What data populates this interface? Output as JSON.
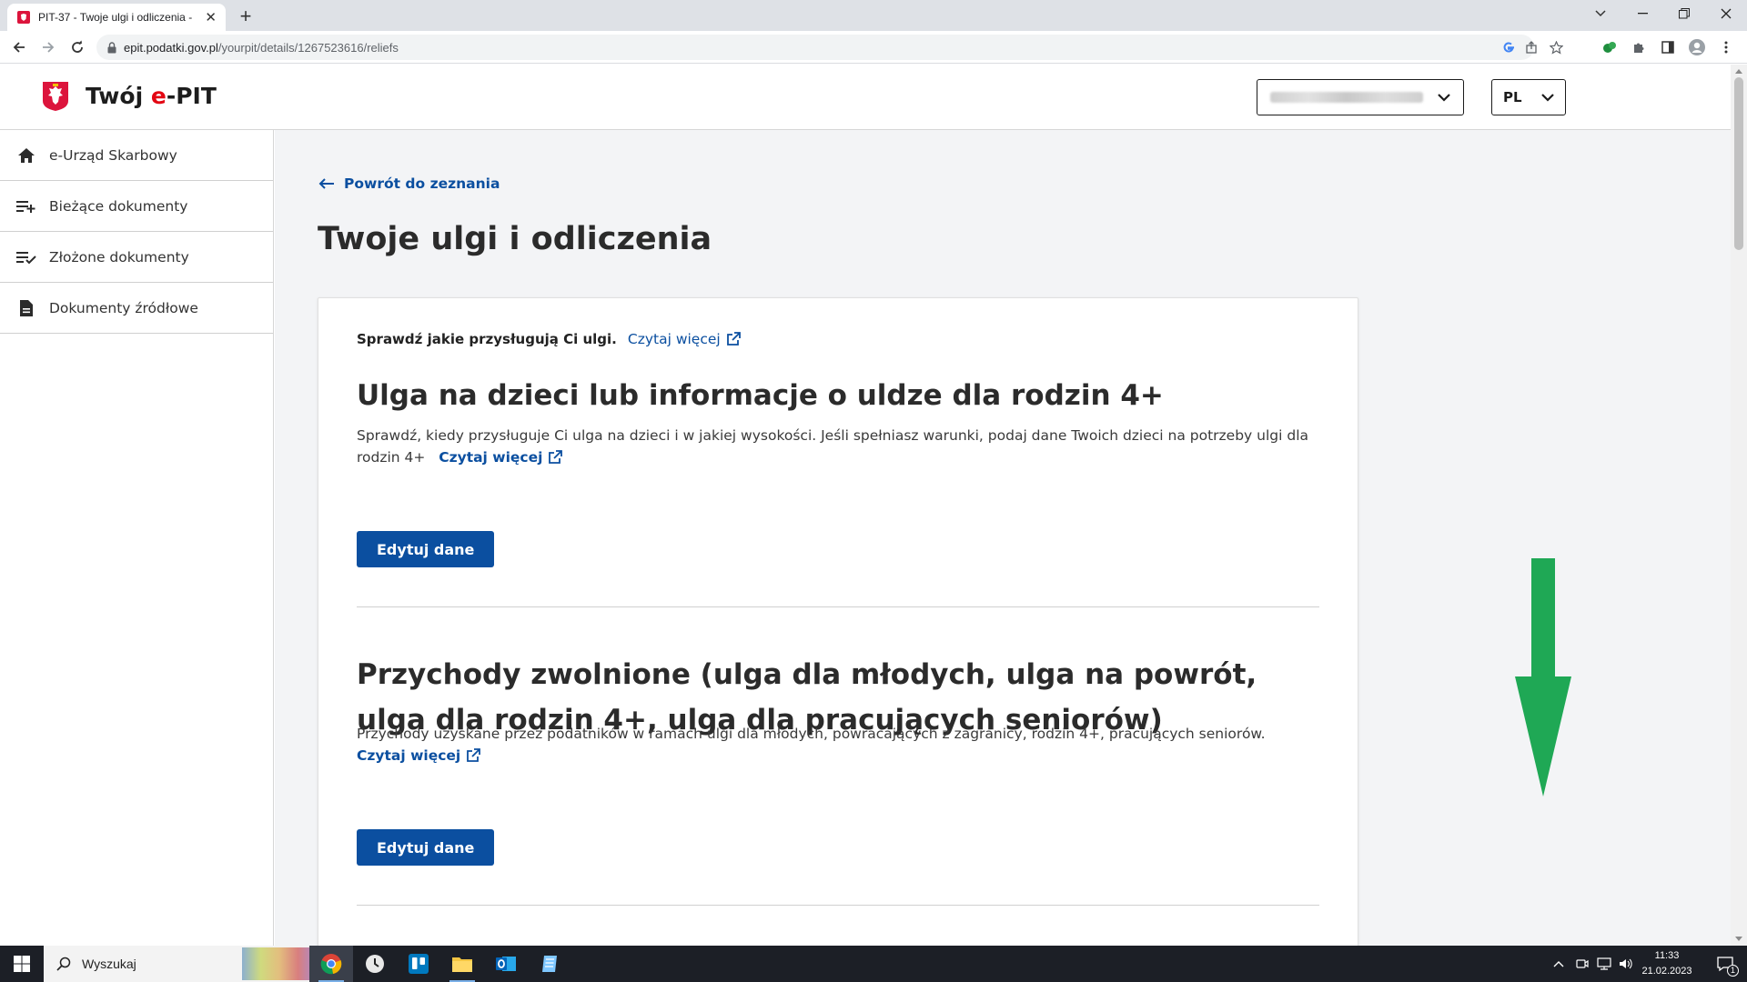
{
  "browser": {
    "tab_title": "PIT-37 - Twoje ulgi i odliczenia -",
    "url_host": "epit.podatki.gov.pl",
    "url_path": "/yourpit/details/1267523616/reliefs"
  },
  "header": {
    "brand_prefix": "Twój ",
    "brand_accent": "e",
    "brand_suffix": "-PIT",
    "language": "PL"
  },
  "sidebar": {
    "items": [
      {
        "label": "e-Urząd Skarbowy"
      },
      {
        "label": "Bieżące dokumenty"
      },
      {
        "label": "Złożone dokumenty"
      },
      {
        "label": "Dokumenty źródłowe"
      }
    ]
  },
  "main": {
    "back_label": "Powrót do zeznania",
    "title": "Twoje ulgi i odliczenia",
    "intro_text": "Sprawdź jakie przysługują Ci ulgi.",
    "intro_link": "Czytaj więcej",
    "sections": [
      {
        "title": "Ulga na dzieci lub informacje o uldze dla rodzin 4+",
        "description": "Sprawdź, kiedy przysługuje Ci ulga na dzieci i w jakiej wysokości. Jeśli spełniasz warunki, podaj dane Twoich dzieci na potrzeby ulgi dla rodzin 4+",
        "link": "Czytaj więcej",
        "button": "Edytuj dane"
      },
      {
        "title": "Przychody zwolnione (ulga dla młodych, ulga na powrót, ulga dla rodzin 4+, ulga dla pracujących seniorów)",
        "description": "Przychody uzyskane przez podatników w ramach ulgi dla młodych, powracających z zagranicy, rodzin 4+, pracujących seniorów.",
        "link": "Czytaj więcej",
        "button": "Edytuj dane"
      }
    ]
  },
  "taskbar": {
    "search_placeholder": "Wyszukaj",
    "time": "11:33",
    "date": "21.02.2023",
    "notification_count": "1"
  },
  "colors": {
    "primary": "#0b4fa0",
    "brand_red": "#e30613",
    "annotation_arrow": "#1fa855"
  },
  "icons": {
    "annotation": "down-arrow-annotation"
  }
}
